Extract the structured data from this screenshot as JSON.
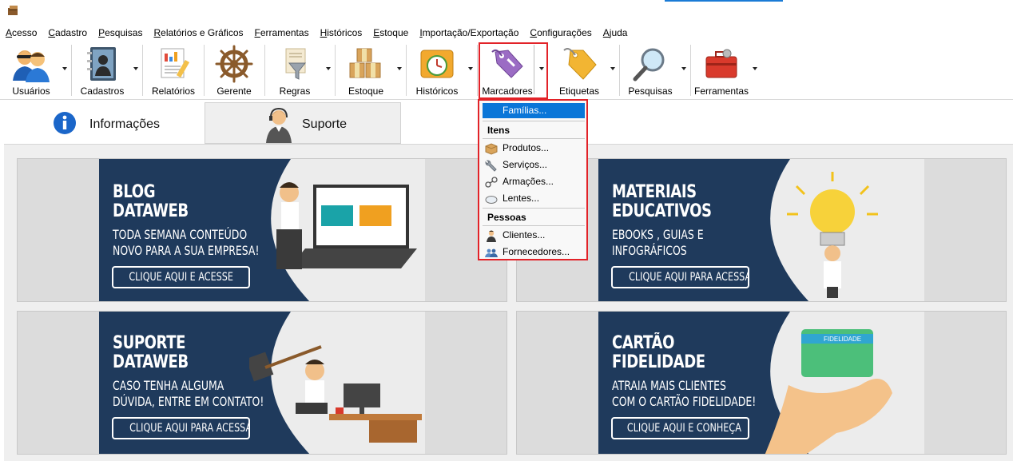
{
  "menu": [
    "Acesso",
    "Cadastro",
    "Pesquisas",
    "Relatórios e Gráficos",
    "Ferramentas",
    "Históricos",
    "Estoque",
    "Importação/Exportação",
    "Configurações",
    "Ajuda"
  ],
  "toolbar": {
    "usuarios": "Usuários",
    "cadastros": "Cadastros",
    "relatorios": "Relatórios",
    "gerente": "Gerente",
    "regras": "Regras",
    "estoque": "Estoque",
    "historicos": "Históricos",
    "marcadores": "Marcadores",
    "etiquetas": "Etiquetas",
    "pesquisas": "Pesquisas",
    "ferramentas": "Ferramentas"
  },
  "tabs": {
    "info": "Informações",
    "suporte": "Suporte"
  },
  "dropdown": {
    "familias": "Famílias...",
    "itens_header": "Itens",
    "produtos": "Produtos...",
    "servicos": "Serviços...",
    "armacoes": "Armações...",
    "lentes": "Lentes...",
    "pessoas_header": "Pessoas",
    "clientes": "Clientes...",
    "fornecedores": "Fornecedores..."
  },
  "cards": {
    "blog": {
      "title1": "BLOG",
      "title2": "DATAWEB",
      "sub1": "TODA SEMANA CONTEÚDO",
      "sub2": "NOVO PARA A SUA EMPRESA!",
      "cta": "CLIQUE AQUI E ACESSE"
    },
    "materiais": {
      "title1": "MATERIAIS",
      "title2": "EDUCATIVOS",
      "sub1": "EBOOKS , GUIAS E",
      "sub2": "INFOGRÁFICOS",
      "cta": "CLIQUE AQUI PARA ACESSAR"
    },
    "suporte": {
      "title1": "SUPORTE",
      "title2": "DATAWEB",
      "sub1": "CASO TENHA ALGUMA",
      "sub2": "DÚVIDA, ENTRE EM CONTATO!",
      "cta": "CLIQUE AQUI PARA ACESSAR"
    },
    "cartao": {
      "title1": "CARTÃO",
      "title2": "FIDELIDADE",
      "sub1": "ATRAIA MAIS CLIENTES",
      "sub2": "COM O CARTÃO FIDELIDADE!",
      "cta": "CLIQUE AQUI E CONHEÇA",
      "card_label": "FIDELIDADE"
    }
  },
  "colors": {
    "navy": "#1f3a5c",
    "highlight_border": "#e22228",
    "selection": "#0a76d8"
  }
}
